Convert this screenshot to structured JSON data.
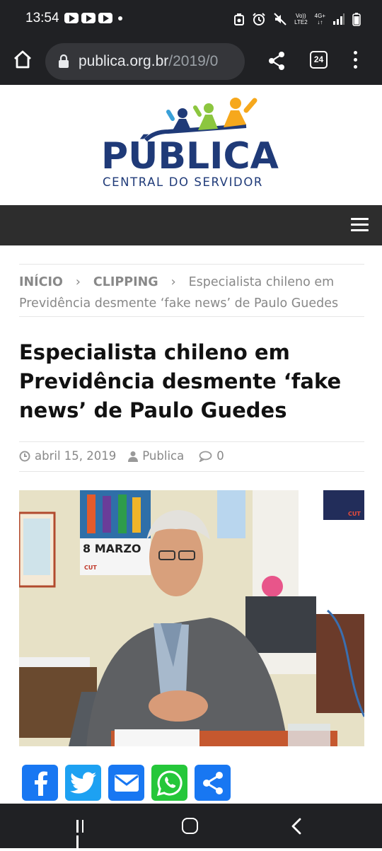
{
  "status_bar": {
    "time": "13:54",
    "net_top": "Vo))",
    "net_bottom": "LTE2",
    "signal_type": "4G+"
  },
  "browser": {
    "url_domain": "publica.org.br",
    "url_path": "/2019/0",
    "tab_count": "24"
  },
  "site": {
    "logo_title": "PÚBLICA",
    "logo_subtitle": "CENTRAL DO SERVIDOR"
  },
  "breadcrumb": {
    "home": "INÍCIO",
    "section": "CLIPPING",
    "current": "Especialista chileno em Previdência desmente ‘fake news’ de Paulo Guedes"
  },
  "article": {
    "title": "Especialista chileno em Previdência desmente ‘fake news’ de Paulo Guedes",
    "date": "abril 15, 2019",
    "author": "Publica",
    "comments": "0"
  },
  "photo": {
    "poster_text": "8 MARZO",
    "poster_brand": "CUT",
    "sticker_brand": "CUT"
  },
  "colors": {
    "brand_blue": "#1f3a78",
    "facebook": "#1877f2",
    "twitter": "#1da1f2",
    "email": "#1877f2",
    "whatsapp": "#25c73a",
    "share": "#1877f2"
  }
}
